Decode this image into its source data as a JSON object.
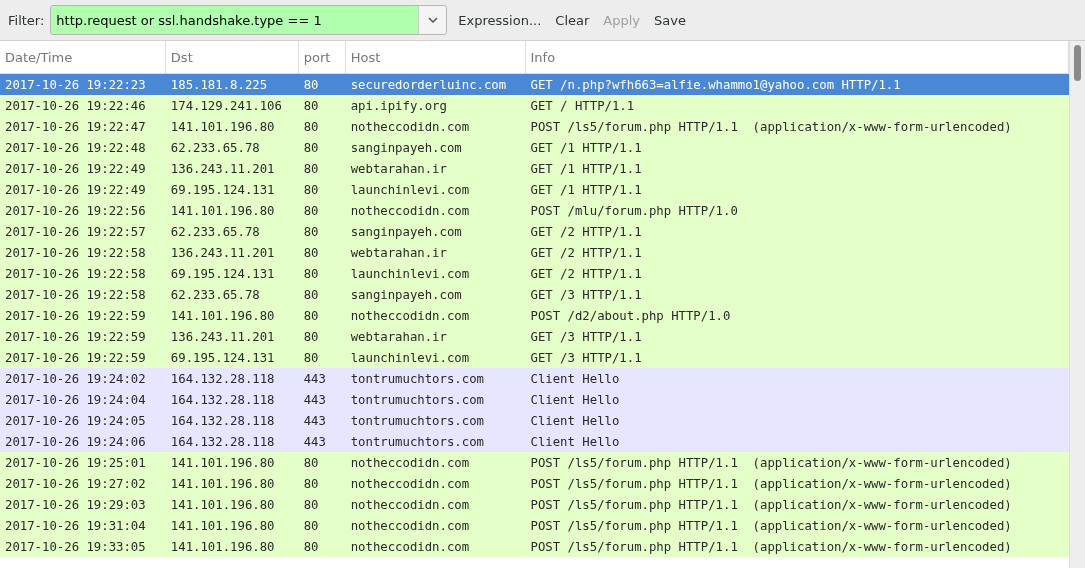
{
  "filter_bar": {
    "label": "Filter:",
    "value": "http.request or ssl.handshake.type == 1",
    "valid": true,
    "buttons": [
      {
        "label": "Expression...",
        "disabled": false
      },
      {
        "label": "Clear",
        "disabled": false
      },
      {
        "label": "Apply",
        "disabled": true
      },
      {
        "label": "Save",
        "disabled": false
      }
    ]
  },
  "table": {
    "columns": [
      "Date/Time",
      "Dst",
      "port",
      "Host",
      "Info"
    ],
    "rows": [
      {
        "kind": "http",
        "selected": true,
        "cells": [
          "2017-10-26 19:22:23",
          "185.181.8.225",
          "80",
          "securedorderluinc.com",
          "GET /n.php?wfh663=alfie.whammo1@yahoo.com HTTP/1.1"
        ]
      },
      {
        "kind": "http",
        "selected": false,
        "cells": [
          "2017-10-26 19:22:46",
          "174.129.241.106",
          "80",
          "api.ipify.org",
          "GET / HTTP/1.1"
        ]
      },
      {
        "kind": "http",
        "selected": false,
        "cells": [
          "2017-10-26 19:22:47",
          "141.101.196.80",
          "80",
          "notheccodidn.com",
          "POST /ls5/forum.php HTTP/1.1  (application/x-www-form-urlencoded)"
        ]
      },
      {
        "kind": "http",
        "selected": false,
        "cells": [
          "2017-10-26 19:22:48",
          "62.233.65.78",
          "80",
          "sanginpayeh.com",
          "GET /1 HTTP/1.1"
        ]
      },
      {
        "kind": "http",
        "selected": false,
        "cells": [
          "2017-10-26 19:22:49",
          "136.243.11.201",
          "80",
          "webtarahan.ir",
          "GET /1 HTTP/1.1"
        ]
      },
      {
        "kind": "http",
        "selected": false,
        "cells": [
          "2017-10-26 19:22:49",
          "69.195.124.131",
          "80",
          "launchinlevi.com",
          "GET /1 HTTP/1.1"
        ]
      },
      {
        "kind": "http",
        "selected": false,
        "cells": [
          "2017-10-26 19:22:56",
          "141.101.196.80",
          "80",
          "notheccodidn.com",
          "POST /mlu/forum.php HTTP/1.0"
        ]
      },
      {
        "kind": "http",
        "selected": false,
        "cells": [
          "2017-10-26 19:22:57",
          "62.233.65.78",
          "80",
          "sanginpayeh.com",
          "GET /2 HTTP/1.1"
        ]
      },
      {
        "kind": "http",
        "selected": false,
        "cells": [
          "2017-10-26 19:22:58",
          "136.243.11.201",
          "80",
          "webtarahan.ir",
          "GET /2 HTTP/1.1"
        ]
      },
      {
        "kind": "http",
        "selected": false,
        "cells": [
          "2017-10-26 19:22:58",
          "69.195.124.131",
          "80",
          "launchinlevi.com",
          "GET /2 HTTP/1.1"
        ]
      },
      {
        "kind": "http",
        "selected": false,
        "cells": [
          "2017-10-26 19:22:58",
          "62.233.65.78",
          "80",
          "sanginpayeh.com",
          "GET /3 HTTP/1.1"
        ]
      },
      {
        "kind": "http",
        "selected": false,
        "cells": [
          "2017-10-26 19:22:59",
          "141.101.196.80",
          "80",
          "notheccodidn.com",
          "POST /d2/about.php HTTP/1.0"
        ]
      },
      {
        "kind": "http",
        "selected": false,
        "cells": [
          "2017-10-26 19:22:59",
          "136.243.11.201",
          "80",
          "webtarahan.ir",
          "GET /3 HTTP/1.1"
        ]
      },
      {
        "kind": "http",
        "selected": false,
        "cells": [
          "2017-10-26 19:22:59",
          "69.195.124.131",
          "80",
          "launchinlevi.com",
          "GET /3 HTTP/1.1"
        ]
      },
      {
        "kind": "ssl",
        "selected": false,
        "cells": [
          "2017-10-26 19:24:02",
          "164.132.28.118",
          "443",
          "tontrumuchtors.com",
          "Client Hello"
        ]
      },
      {
        "kind": "ssl",
        "selected": false,
        "cells": [
          "2017-10-26 19:24:04",
          "164.132.28.118",
          "443",
          "tontrumuchtors.com",
          "Client Hello"
        ]
      },
      {
        "kind": "ssl",
        "selected": false,
        "cells": [
          "2017-10-26 19:24:05",
          "164.132.28.118",
          "443",
          "tontrumuchtors.com",
          "Client Hello"
        ]
      },
      {
        "kind": "ssl",
        "selected": false,
        "cells": [
          "2017-10-26 19:24:06",
          "164.132.28.118",
          "443",
          "tontrumuchtors.com",
          "Client Hello"
        ]
      },
      {
        "kind": "http",
        "selected": false,
        "cells": [
          "2017-10-26 19:25:01",
          "141.101.196.80",
          "80",
          "notheccodidn.com",
          "POST /ls5/forum.php HTTP/1.1  (application/x-www-form-urlencoded)"
        ]
      },
      {
        "kind": "http",
        "selected": false,
        "cells": [
          "2017-10-26 19:27:02",
          "141.101.196.80",
          "80",
          "notheccodidn.com",
          "POST /ls5/forum.php HTTP/1.1  (application/x-www-form-urlencoded)"
        ]
      },
      {
        "kind": "http",
        "selected": false,
        "cells": [
          "2017-10-26 19:29:03",
          "141.101.196.80",
          "80",
          "notheccodidn.com",
          "POST /ls5/forum.php HTTP/1.1  (application/x-www-form-urlencoded)"
        ]
      },
      {
        "kind": "http",
        "selected": false,
        "cells": [
          "2017-10-26 19:31:04",
          "141.101.196.80",
          "80",
          "notheccodidn.com",
          "POST /ls5/forum.php HTTP/1.1  (application/x-www-form-urlencoded)"
        ]
      },
      {
        "kind": "http",
        "selected": false,
        "cells": [
          "2017-10-26 19:33:05",
          "141.101.196.80",
          "80",
          "notheccodidn.com",
          "POST /ls5/forum.php HTTP/1.1  (application/x-www-form-urlencoded)"
        ]
      }
    ]
  }
}
